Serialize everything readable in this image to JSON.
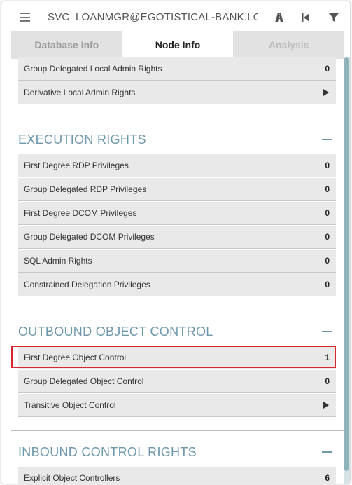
{
  "header": {
    "title": "SVC_LOANMGR@EGOTISTICAL-BANK.LOCA",
    "icons": [
      "menu-icon",
      "path-icon",
      "back-icon",
      "filter-icon"
    ]
  },
  "tabs": [
    {
      "label": "Database Info",
      "state": "inactive"
    },
    {
      "label": "Node Info",
      "state": "active"
    },
    {
      "label": "Analysis",
      "state": "disabled"
    }
  ],
  "top_rows": [
    {
      "label": "Group Delegated Local Admin Rights",
      "value": "0"
    },
    {
      "label": "Derivative Local Admin Rights",
      "value": "",
      "expand": true
    }
  ],
  "sections": [
    {
      "title": "EXECUTION RIGHTS",
      "rows": [
        {
          "label": "First Degree RDP Privileges",
          "value": "0"
        },
        {
          "label": "Group Delegated RDP Privileges",
          "value": "0"
        },
        {
          "label": "First Degree DCOM Privileges",
          "value": "0"
        },
        {
          "label": "Group Delegated DCOM Privileges",
          "value": "0"
        },
        {
          "label": "SQL Admin Rights",
          "value": "0"
        },
        {
          "label": "Constrained Delegation Privileges",
          "value": "0"
        }
      ]
    },
    {
      "title": "OUTBOUND OBJECT CONTROL",
      "rows": [
        {
          "label": "First Degree Object Control",
          "value": "1"
        },
        {
          "label": "Group Delegated Object Control",
          "value": "0"
        },
        {
          "label": "Transitive Object Control",
          "value": "",
          "expand": true
        }
      ]
    },
    {
      "title": "INBOUND CONTROL RIGHTS",
      "rows": [
        {
          "label": "Explicit Object Controllers",
          "value": "6"
        }
      ]
    }
  ],
  "colors": {
    "section_title": "#6e98ab",
    "highlight_border": "#d9262c",
    "row_background": "#e9e9e9"
  }
}
